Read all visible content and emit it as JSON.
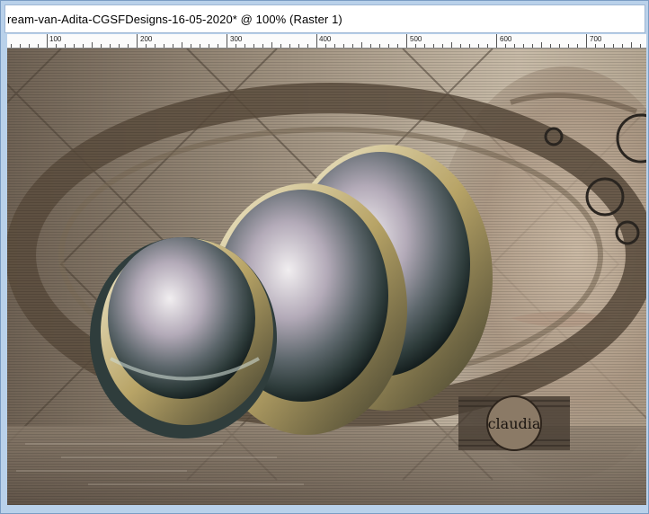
{
  "window": {
    "title": "ream-van-Adita-CGSFDesigns-16-05-2020* @ 100% (Raster 1)"
  },
  "ruler": {
    "labels": [
      "100",
      "200",
      "300",
      "400",
      "500",
      "600",
      "700"
    ]
  },
  "canvas": {
    "watermark_text": "claudia",
    "colors": {
      "bg_dark": "#6f6254",
      "bg_mid": "#a29482",
      "bg_light": "#c8bba8",
      "ring": "#5a4c3d",
      "sphere_gold": "#c9b98a",
      "sphere_teal": "#3f5553"
    }
  }
}
